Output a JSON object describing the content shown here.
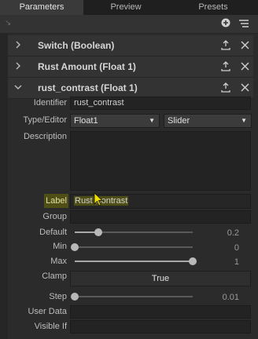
{
  "tabs": [
    "Parameters",
    "Preview",
    "Presets"
  ],
  "sections": [
    {
      "title": "Switch (Boolean)",
      "expanded": false
    },
    {
      "title": "Rust Amount (Float 1)",
      "expanded": false
    },
    {
      "title": "rust_contrast (Float 1)",
      "expanded": true
    }
  ],
  "fields": {
    "identifier_label": "Identifier",
    "identifier_value": "rust_contrast",
    "type_label": "Type/Editor",
    "type_value": "Float1",
    "editor_value": "Slider",
    "description_label": "Description",
    "label_label": "Label",
    "label_value": "Rust Contrast",
    "group_label": "Group",
    "default_label": "Default",
    "default_value": "0.2",
    "default_fraction": 0.2,
    "min_label": "Min",
    "min_value": "0",
    "min_fraction": 0.0,
    "max_label": "Max",
    "max_value": "1",
    "max_fraction": 1.0,
    "clamp_label": "Clamp",
    "clamp_value": "True",
    "step_label": "Step",
    "step_value": "0.01",
    "step_fraction": 0.0,
    "userdata_label": "User Data",
    "visibleif_label": "Visible If"
  },
  "colors": {
    "highlight": "#4e4e16",
    "cursor": "#f0e000"
  }
}
